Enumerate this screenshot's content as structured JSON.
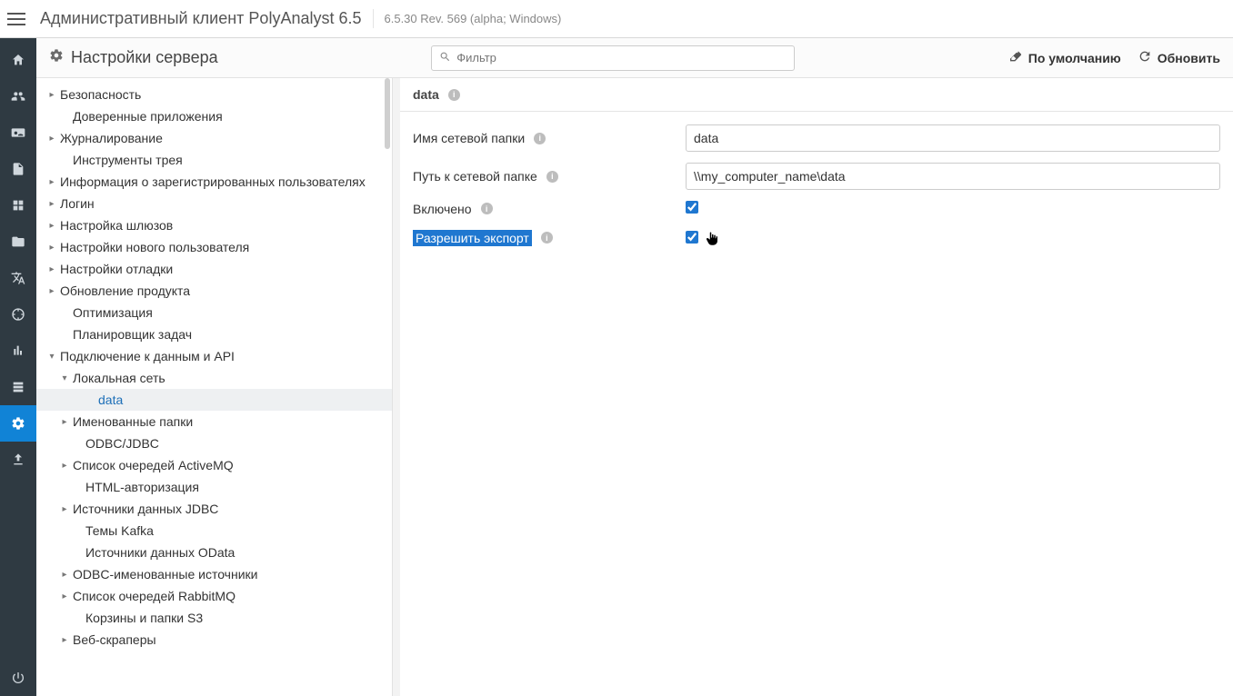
{
  "topbar": {
    "title": "Административный клиент PolyAnalyst 6.5",
    "version": "6.5.30 Rev. 569 (alpha; Windows)"
  },
  "toolbar": {
    "title": "Настройки сервера",
    "filter_placeholder": "Фильтр",
    "defaults_label": "По умолчанию",
    "refresh_label": "Обновить"
  },
  "iconbar_names": [
    "nav-home",
    "nav-users",
    "nav-card",
    "nav-doc",
    "nav-modules",
    "nav-folder",
    "nav-lang",
    "nav-target",
    "nav-chart",
    "nav-storage",
    "nav-settings",
    "nav-upload"
  ],
  "iconbar_active_index": 10,
  "iconbar_footer_name": "nav-power",
  "tree": [
    {
      "depth": 0,
      "expander": "▸",
      "label": "Безопасность"
    },
    {
      "depth": 1,
      "expander": "",
      "label": "Доверенные приложения"
    },
    {
      "depth": 0,
      "expander": "▸",
      "label": "Журналирование"
    },
    {
      "depth": 1,
      "expander": "",
      "label": "Инструменты трея"
    },
    {
      "depth": 0,
      "expander": "▸",
      "label": "Информация о зарегистрированных пользователях"
    },
    {
      "depth": 0,
      "expander": "▸",
      "label": "Логин"
    },
    {
      "depth": 0,
      "expander": "▸",
      "label": "Настройка шлюзов"
    },
    {
      "depth": 0,
      "expander": "▸",
      "label": "Настройки нового пользователя"
    },
    {
      "depth": 0,
      "expander": "▸",
      "label": "Настройки отладки"
    },
    {
      "depth": 0,
      "expander": "▸",
      "label": "Обновление продукта"
    },
    {
      "depth": 1,
      "expander": "",
      "label": "Оптимизация"
    },
    {
      "depth": 1,
      "expander": "",
      "label": "Планировщик задач"
    },
    {
      "depth": 0,
      "expander": "▾",
      "label": "Подключение к данным и API"
    },
    {
      "depth": 1,
      "expander": "▾",
      "label": "Локальная сеть"
    },
    {
      "depth": 3,
      "expander": "",
      "label": "data",
      "selected": true
    },
    {
      "depth": 1,
      "expander": "▸",
      "label": "Именованные папки"
    },
    {
      "depth": 2,
      "expander": "",
      "label": "ODBC/JDBC"
    },
    {
      "depth": 1,
      "expander": "▸",
      "label": "Список очередей ActiveMQ"
    },
    {
      "depth": 2,
      "expander": "",
      "label": "HTML-авторизация"
    },
    {
      "depth": 1,
      "expander": "▸",
      "label": "Источники данных JDBC"
    },
    {
      "depth": 2,
      "expander": "",
      "label": "Темы Kafka"
    },
    {
      "depth": 2,
      "expander": "",
      "label": "Источники данных OData"
    },
    {
      "depth": 1,
      "expander": "▸",
      "label": "ODBC-именованные источники"
    },
    {
      "depth": 1,
      "expander": "▸",
      "label": "Список очередей RabbitMQ"
    },
    {
      "depth": 2,
      "expander": "",
      "label": "Корзины и папки S3"
    },
    {
      "depth": 1,
      "expander": "▸",
      "label": "Веб-скраперы"
    }
  ],
  "content": {
    "title": "data",
    "fields": {
      "name_label": "Имя сетевой папки",
      "name_value": "data",
      "path_label": "Путь к сетевой папке",
      "path_value": "\\\\my_computer_name\\data",
      "enabled_label": "Включено",
      "enabled_value": true,
      "export_label": "Разрешить экспорт",
      "export_value": true
    }
  }
}
